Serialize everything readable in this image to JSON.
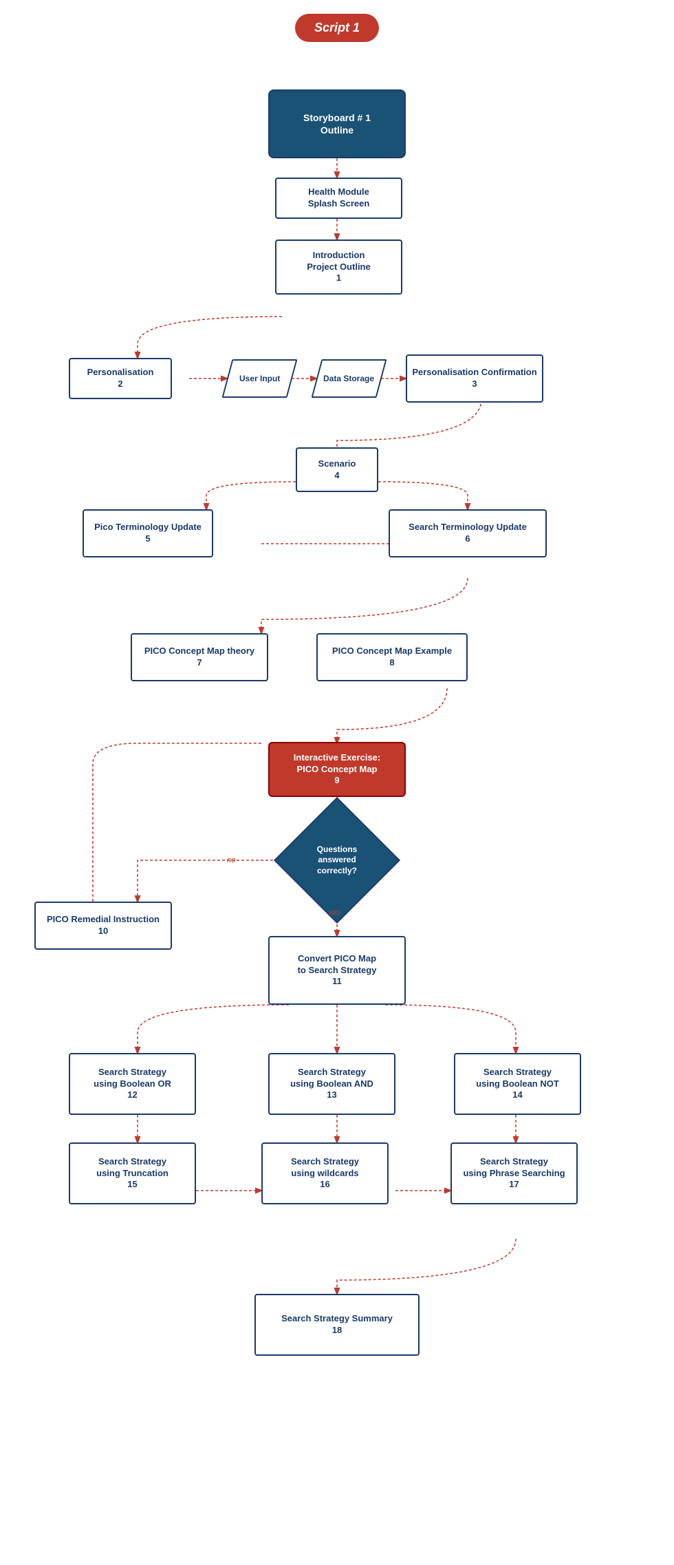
{
  "title": "Script 1",
  "nodes": {
    "script": "Script 1",
    "storyboard": "Storyboard # 1\nOutline",
    "health_module": "Health Module\nSplash Screen",
    "intro_project": "Introduction\nProject Outline\n1",
    "personalisation2": "Personalisation\n2",
    "user_input": "User Input",
    "data_storage": "Data Storage",
    "personalisation3": "Personalisation Confirmation\n3",
    "scenario4": "Scenario\n4",
    "pico_terminology": "Pico Terminology Update\n5",
    "search_terminology": "Search Terminology Update\n6",
    "pico_concept_theory": "PICO Concept Map theory\n7",
    "pico_concept_example": "PICO Concept Map Example\n8",
    "interactive_exercise": "Interactive Exercise:\nPICO Concept Map\n9",
    "questions_diamond": "Questions\nanswered\ncorrectly?",
    "pico_remedial": "PICO Remedial Instruction\n10",
    "convert_pico": "Convert PICO Map\nto Search Strategy\n11",
    "bool_or": "Search Strategy\nusing Boolean OR\n12",
    "bool_and": "Search Strategy\nusing Boolean AND\n13",
    "bool_not": "Search Strategy\nusing Boolean NOT\n14",
    "truncation": "Search Strategy\nusing Truncation\n15",
    "wildcards": "Search Strategy\nusing wildcards\n16",
    "phrase_searching": "Search Strategy\nusing Phrase Searching\n17",
    "summary18": "Search Strategy Summary\n18"
  },
  "labels": {
    "no": "no",
    "yes": "yes"
  }
}
